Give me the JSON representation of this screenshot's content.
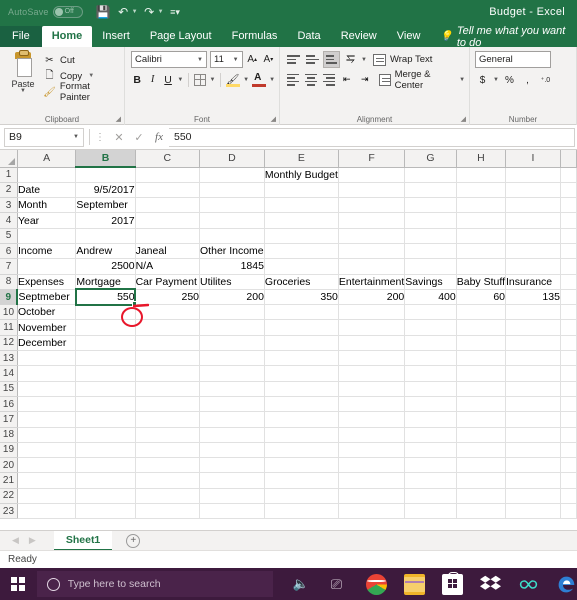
{
  "titlebar": {
    "autosave_label": "AutoSave",
    "autosave_state": "Off",
    "save_icon": "save-icon",
    "undo_icon": "undo-icon",
    "redo_icon": "redo-icon",
    "customize_icon": "customize-quick-access-icon",
    "document_title": "Budget  -  Excel"
  },
  "tabs": [
    {
      "label": "File",
      "active": false
    },
    {
      "label": "Home",
      "active": true
    },
    {
      "label": "Insert",
      "active": false
    },
    {
      "label": "Page Layout",
      "active": false
    },
    {
      "label": "Formulas",
      "active": false
    },
    {
      "label": "Data",
      "active": false
    },
    {
      "label": "Review",
      "active": false
    },
    {
      "label": "View",
      "active": false
    }
  ],
  "tellme": {
    "placeholder": "Tell me what you want to do",
    "icon": "lightbulb-icon"
  },
  "ribbon": {
    "clipboard": {
      "group_label": "Clipboard",
      "paste_label": "Paste",
      "cut_label": "Cut",
      "copy_label": "Copy",
      "format_painter_label": "Format Painter"
    },
    "font": {
      "group_label": "Font",
      "font_name": "Calibri",
      "font_size": "11",
      "grow_font": "A",
      "shrink_font": "A",
      "bold": "B",
      "italic": "I",
      "underline": "U"
    },
    "alignment": {
      "group_label": "Alignment",
      "wrap_text_label": "Wrap Text",
      "merge_center_label": "Merge & Center"
    },
    "number": {
      "group_label": "Number",
      "format_value": "General",
      "currency": "$",
      "percent": "%",
      "comma": ",",
      "increase_decimal": "+.0"
    }
  },
  "formula_bar": {
    "name_box": "B9",
    "cancel_icon": "cancel-icon",
    "enter_icon": "confirm-icon",
    "function_icon": "insert-function-icon",
    "value": "550"
  },
  "grid": {
    "columns": [
      "A",
      "B",
      "C",
      "D",
      "E",
      "F",
      "G",
      "H",
      "I"
    ],
    "selected_column": "B",
    "selected_row": 9,
    "active_cell": "B9",
    "rows": [
      {
        "n": 1,
        "cells": {
          "E": "Monthly Budget"
        }
      },
      {
        "n": 2,
        "cells": {
          "A": "Date",
          "B": "9/5/2017"
        }
      },
      {
        "n": 3,
        "cells": {
          "A": "Month",
          "B": "September"
        }
      },
      {
        "n": 4,
        "cells": {
          "A": "Year",
          "B": "2017"
        }
      },
      {
        "n": 5,
        "cells": {}
      },
      {
        "n": 6,
        "cells": {
          "A": "Income",
          "B": "Andrew",
          "C": "Janeal",
          "D": "Other Income"
        }
      },
      {
        "n": 7,
        "cells": {
          "B": "2500",
          "C": "N/A",
          "D": "1845"
        }
      },
      {
        "n": 8,
        "cells": {
          "A": "Expenses",
          "B": "Mortgage",
          "C": "Car Payment",
          "D": "Utilites",
          "E": "Groceries",
          "F": "Entertainment",
          "G": "Savings",
          "H": "Baby Stuff",
          "I": "Insurance"
        }
      },
      {
        "n": 9,
        "cells": {
          "A": "Septmeber",
          "B": "550",
          "C": "250",
          "D": "200",
          "E": "350",
          "F": "200",
          "G": "400",
          "H": "60",
          "I": "135"
        }
      },
      {
        "n": 10,
        "cells": {
          "A": "October"
        }
      },
      {
        "n": 11,
        "cells": {
          "A": "November"
        }
      },
      {
        "n": 12,
        "cells": {
          "A": "December"
        }
      },
      {
        "n": 13,
        "cells": {}
      },
      {
        "n": 14,
        "cells": {}
      },
      {
        "n": 15,
        "cells": {}
      },
      {
        "n": 16,
        "cells": {}
      },
      {
        "n": 17,
        "cells": {}
      },
      {
        "n": 18,
        "cells": {}
      },
      {
        "n": 19,
        "cells": {}
      },
      {
        "n": 20,
        "cells": {}
      },
      {
        "n": 21,
        "cells": {}
      },
      {
        "n": 22,
        "cells": {}
      },
      {
        "n": 23,
        "cells": {}
      }
    ],
    "right_aligned": {
      "2": [
        "B"
      ],
      "4": [
        "B"
      ],
      "7": [
        "B",
        "D"
      ],
      "9": [
        "B",
        "C",
        "D",
        "E",
        "F",
        "G",
        "H",
        "I"
      ]
    },
    "annotation": {
      "type": "red-circle",
      "target": "fill-handle of B9",
      "color": "#e8172b"
    }
  },
  "sheet_tabs": {
    "tabs": [
      {
        "label": "Sheet1",
        "active": true
      }
    ],
    "add_label": "+",
    "prev_icon": "prev-sheet-icon",
    "next_icon": "next-sheet-icon"
  },
  "status_bar": {
    "text": "Ready"
  },
  "taskbar": {
    "start_icon": "windows-start-icon",
    "search_placeholder": "Type here to search",
    "cortana_icon": "cortana-circle-icon",
    "mic_icon": "microphone-icon",
    "taskview_icon": "task-view-icon",
    "apps": [
      {
        "name": "chrome-icon",
        "running": true
      },
      {
        "name": "file-explorer-icon",
        "running": true
      },
      {
        "name": "microsoft-store-icon",
        "running": false
      },
      {
        "name": "dropbox-icon",
        "running": false
      },
      {
        "name": "infinity-icon",
        "running": false
      },
      {
        "name": "edge-icon",
        "running": false
      }
    ]
  },
  "colors": {
    "excel_green": "#217346",
    "ribbon_bg": "#f3f2f1",
    "annotation_red": "#e8172b",
    "taskbar": "#3d1a3d"
  }
}
